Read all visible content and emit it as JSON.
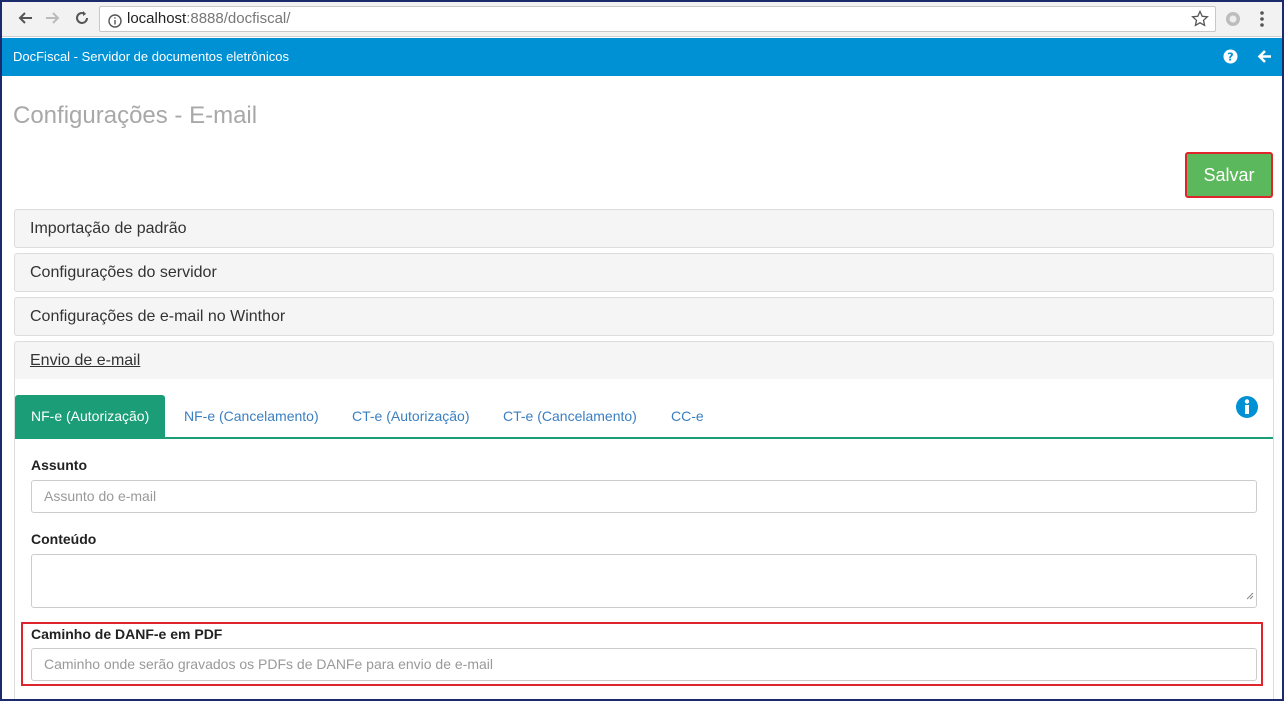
{
  "browser": {
    "url_host": "localhost",
    "url_rest": ":8888/docfiscal/"
  },
  "header": {
    "title": "DocFiscal - Servidor de documentos eletrônicos"
  },
  "page": {
    "title": "Configurações - E-mail",
    "save_label": "Salvar"
  },
  "sections": [
    {
      "label": "Importação de padrão"
    },
    {
      "label": "Configurações do servidor"
    },
    {
      "label": "Configurações de e-mail no Winthor"
    },
    {
      "label": "Envio de e-mail"
    }
  ],
  "tabs": [
    {
      "label": "NF-e (Autorização)",
      "active": true
    },
    {
      "label": "NF-e (Cancelamento)"
    },
    {
      "label": "CT-e (Autorização)"
    },
    {
      "label": "CT-e (Cancelamento)"
    },
    {
      "label": "CC-e"
    }
  ],
  "form": {
    "subject_label": "Assunto",
    "subject_placeholder": "Assunto do e-mail",
    "content_label": "Conteúdo",
    "pdf_path_label": "Caminho de DANF-e em PDF",
    "pdf_path_placeholder": "Caminho onde serão gravados os PDFs de DANFe para envio de e-mail"
  },
  "colors": {
    "header_bg": "#0091d5",
    "save_bg": "#5cb85c",
    "tab_active_bg": "#1b9e77",
    "highlight": "#e0242c"
  },
  "icons": [
    "back-arrow-icon",
    "forward-arrow-icon",
    "reload-icon",
    "info-circle-icon",
    "star-icon",
    "extension-icon",
    "menu-icon",
    "help-icon",
    "back-icon",
    "info-icon"
  ]
}
